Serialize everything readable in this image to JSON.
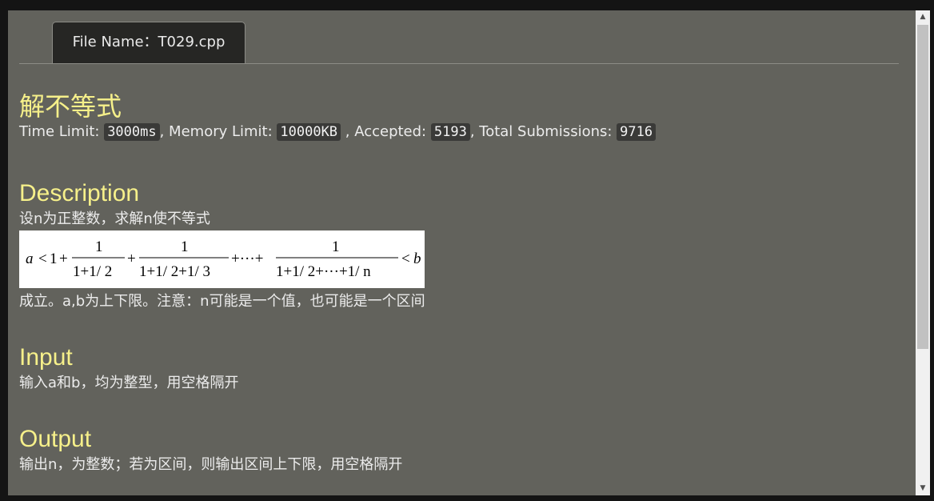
{
  "tab": {
    "label": "File Name：T029.cpp"
  },
  "problem": {
    "title": "解不等式",
    "limits": {
      "time_label": "Time Limit: ",
      "time_value": "3000ms",
      "memory_label": ", Memory Limit: ",
      "memory_value": "10000KB",
      "accepted_label": " , Accepted: ",
      "accepted_value": "5193",
      "total_label": ", Total Submissions: ",
      "total_value": "9716"
    }
  },
  "description": {
    "heading": "Description",
    "line1": "设n为正整数，求解n使不等式",
    "formula": {
      "a": "a",
      "lt": "<",
      "one": "1",
      "plus": "+",
      "num": "1",
      "den1": "1+1/ 2",
      "den2": "1+1/ 2+1/ 3",
      "ellipsis": "+···+",
      "den3": "1+1/ 2+···+1/ n",
      "b": "b"
    },
    "line2": "成立。a,b为上下限。注意：n可能是一个值，也可能是一个区间"
  },
  "input": {
    "heading": "Input",
    "text": "输入a和b，均为整型，用空格隔开"
  },
  "output": {
    "heading": "Output",
    "text": "输出n，为整数；若为区间，则输出区间上下限，用空格隔开"
  }
}
